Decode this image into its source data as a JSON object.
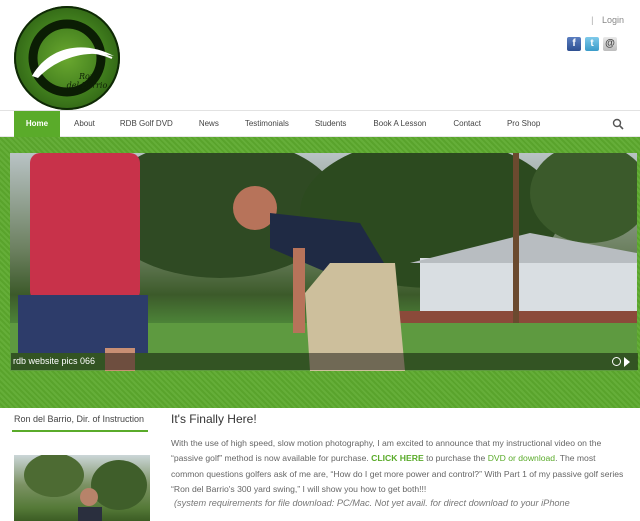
{
  "header": {
    "logo_text_line1": "Ron",
    "logo_text_line2": "del Barrio",
    "top_separator": "|",
    "login_label": "Login",
    "social": [
      {
        "name": "facebook-icon",
        "glyph": "f"
      },
      {
        "name": "twitter-icon",
        "glyph": "t"
      },
      {
        "name": "email-icon",
        "glyph": "@"
      }
    ]
  },
  "nav": {
    "items": [
      "Home",
      "About",
      "RDB Golf DVD",
      "News",
      "Testimonials",
      "Students",
      "Book A Lesson",
      "Contact",
      "Pro Shop"
    ],
    "active_index": 0
  },
  "slider": {
    "caption": "rdb website pics 066"
  },
  "sidebar": {
    "title": "Ron del Barrio, Dir. of Instruction"
  },
  "main": {
    "heading": "It's Finally Here!",
    "p1_a": "With the use of high speed, slow motion photography, I am excited to announce that my instructional video on the “passive golf” method is now available for purchase. ",
    "p1_link1": "CLICK HERE",
    "p1_b": " to purchase the ",
    "p1_link2": "DVD or download",
    "p1_c": ". The most common questions golfers ask of me are, “How do I get more power and control?”  With Part 1 of my passive golf series “Ron del Barrio's 300 yard swing,” I will show you how to get both!!!",
    "note": "(system requirements for file download: PC/Mac. Not yet avail. for direct download to your iPhone"
  },
  "colors": {
    "accent": "#5aab2a",
    "nav_text": "#444444"
  }
}
